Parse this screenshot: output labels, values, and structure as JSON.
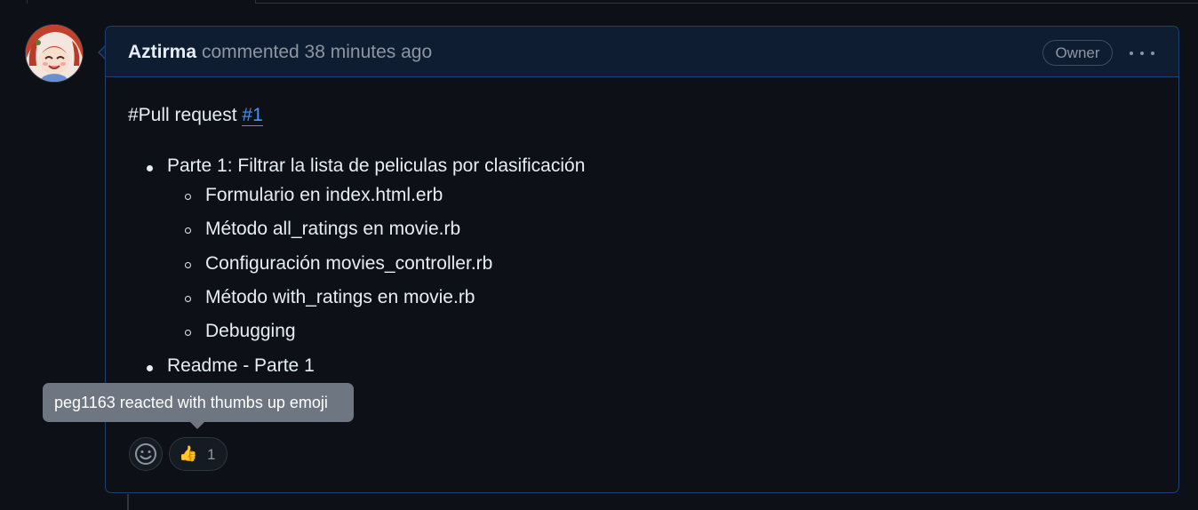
{
  "comment": {
    "author": "Aztirma",
    "meta": "commented 38 minutes ago",
    "badge": "Owner",
    "menu_icon": "kebab-horizontal-icon",
    "avatar_icon": "user-avatar"
  },
  "body": {
    "pr_prefix": "#Pull request ",
    "pr_link": "#1",
    "items": [
      {
        "label": "Parte 1: Filtrar la lista de peliculas por clasificación",
        "sub": [
          "Formulario en index.html.erb",
          "Método all_ratings en movie.rb",
          "Configuración movies_controller.rb",
          "Método with_ratings en movie.rb",
          "Debugging"
        ]
      },
      {
        "label": "Readme - Parte 1",
        "sub": []
      }
    ]
  },
  "reactions": {
    "add_icon": "smiley-icon",
    "thumbs_up": {
      "emoji": "👍",
      "count": "1"
    },
    "tooltip": "peg1163 reacted with thumbs up emoji"
  },
  "colors": {
    "link": "#4493f8",
    "header_bg": "#0f1d33",
    "border": "#1f4072",
    "tooltip_bg": "#6e7681"
  }
}
